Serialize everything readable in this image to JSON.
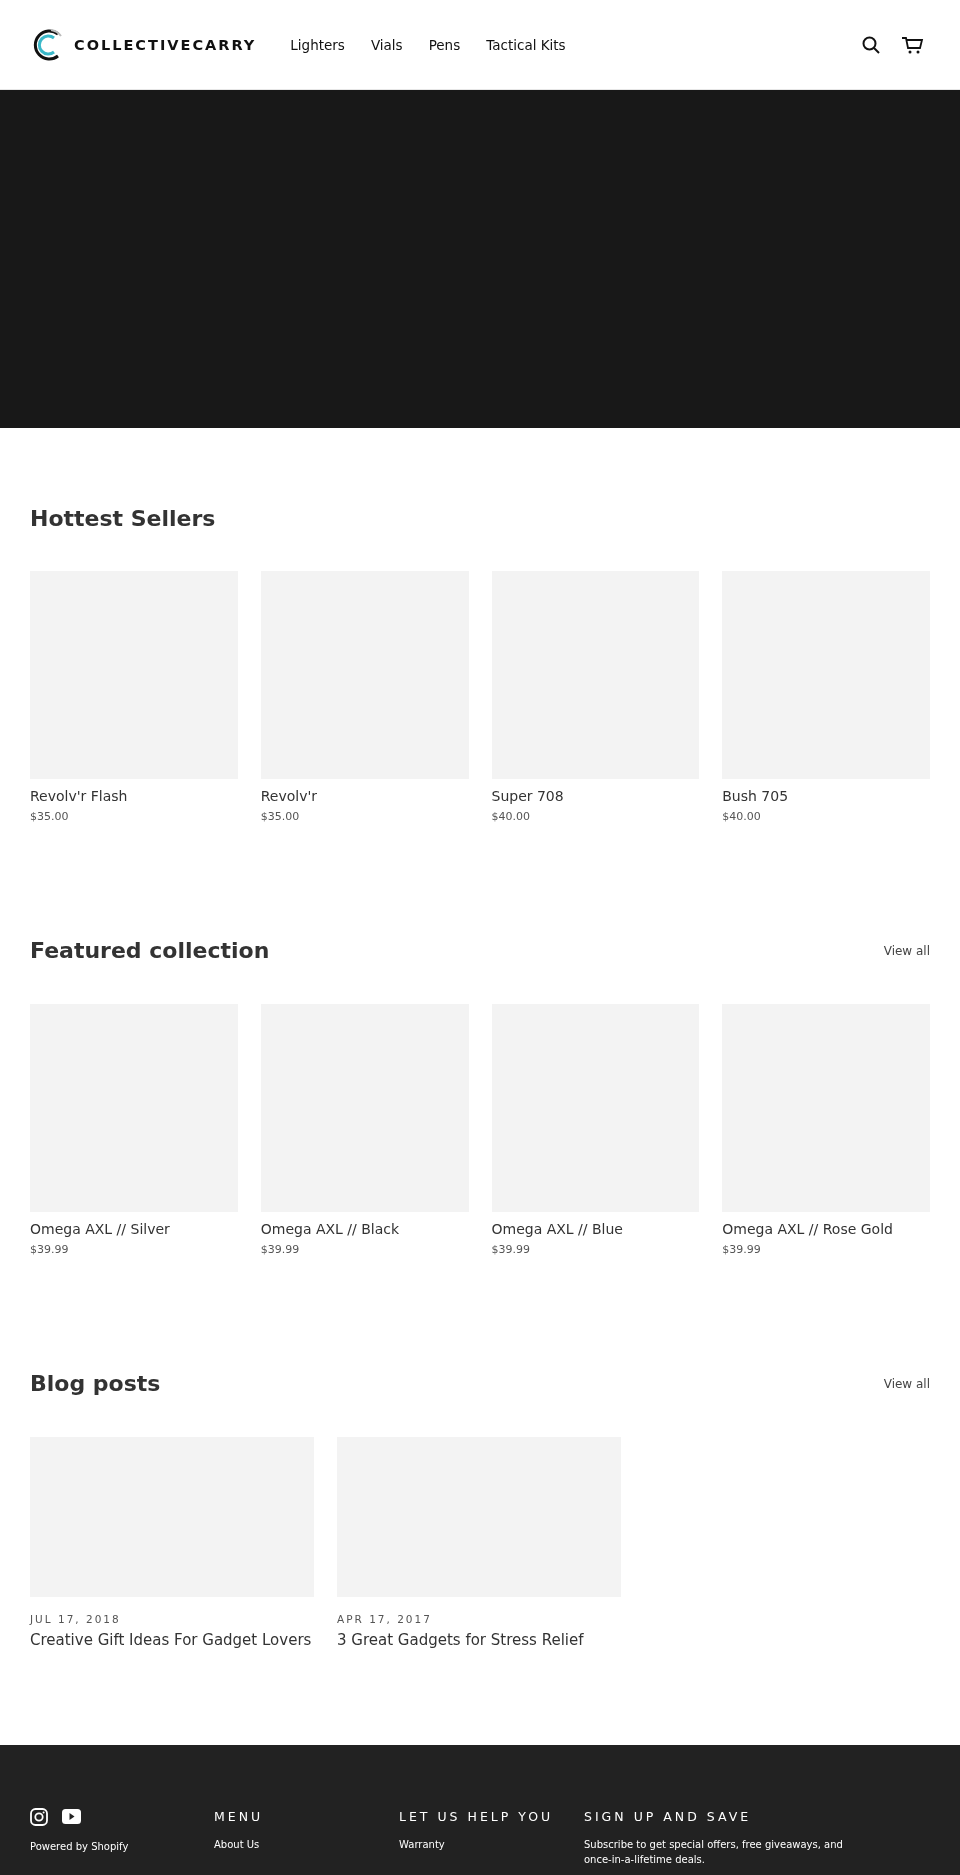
{
  "header": {
    "logo": "COLLECTIVECARRY",
    "nav": [
      "Lighters",
      "Vials",
      "Pens",
      "Tactical Kits"
    ]
  },
  "sections": [
    {
      "title": "Hottest Sellers",
      "products": [
        {
          "name": "Revolv'r Flash",
          "price": "$35.00"
        },
        {
          "name": "Revolv'r",
          "price": "$35.00"
        },
        {
          "name": "Super 708",
          "price": "$40.00"
        },
        {
          "name": "Bush 705",
          "price": "$40.00"
        }
      ]
    },
    {
      "title": "Featured collection",
      "link": "View all",
      "products": [
        {
          "name": "Omega AXL // Silver",
          "price": "$39.99"
        },
        {
          "name": "Omega AXL // Black",
          "price": "$39.99"
        },
        {
          "name": "Omega AXL // Blue",
          "price": "$39.99"
        },
        {
          "name": "Omega AXL // Rose Gold",
          "price": "$39.99"
        }
      ]
    }
  ],
  "blog": {
    "title": "Blog posts",
    "link": "View all",
    "posts": [
      {
        "date": "JUL 17, 2018",
        "title": "Creative Gift Ideas For Gadget Lovers"
      },
      {
        "date": "APR 17, 2017",
        "title": "3 Great Gadgets for Stress Relief"
      }
    ]
  },
  "footer": {
    "powered": "Powered by Shopify",
    "columns": [
      {
        "heading": "MENU",
        "links": [
          "About Us"
        ]
      },
      {
        "heading": "LET US HELP YOU",
        "links": [
          "Warranty"
        ]
      }
    ],
    "signup": {
      "heading": "SIGN UP AND SAVE",
      "text": "Subscribe to get special offers, free giveaways, and once-in-a-lifetime deals."
    }
  }
}
